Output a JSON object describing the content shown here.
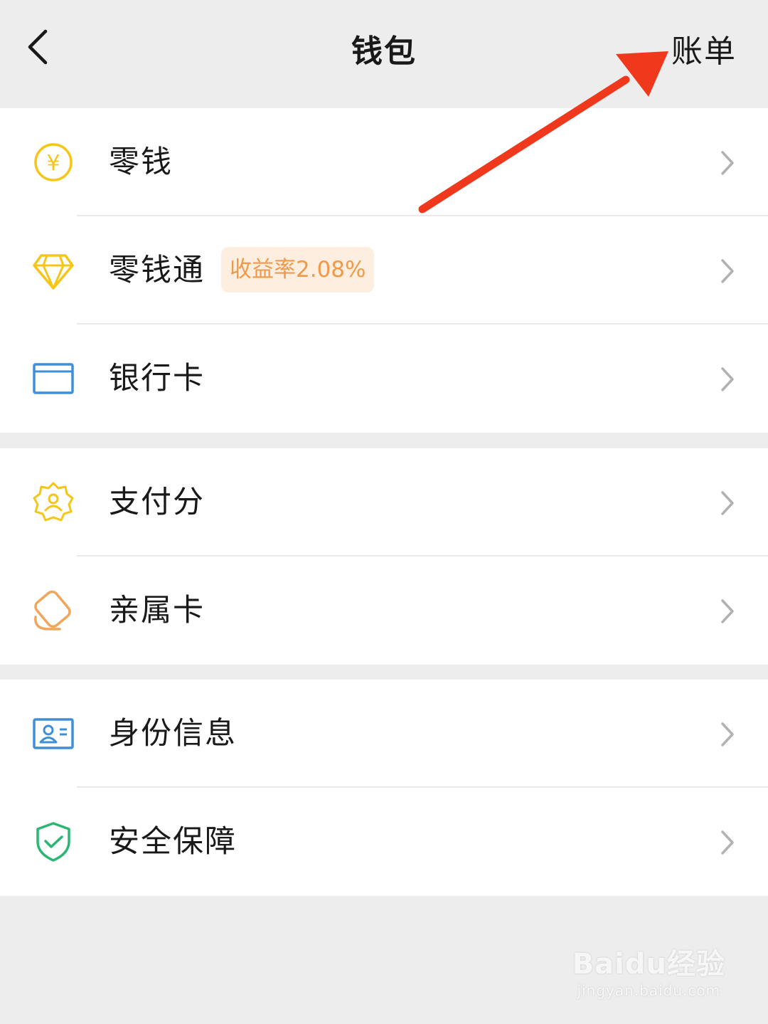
{
  "header": {
    "title": "钱包",
    "bill_label": "账单"
  },
  "groups": [
    {
      "items": [
        {
          "label": "零钱",
          "icon": "yuan-coin-icon"
        },
        {
          "label": "零钱通",
          "icon": "diamond-icon",
          "badge": "收益率2.08%"
        },
        {
          "label": "银行卡",
          "icon": "bank-card-icon"
        }
      ]
    },
    {
      "items": [
        {
          "label": "支付分",
          "icon": "pay-score-icon"
        },
        {
          "label": "亲属卡",
          "icon": "family-card-icon"
        }
      ]
    },
    {
      "items": [
        {
          "label": "身份信息",
          "icon": "id-card-icon"
        },
        {
          "label": "安全保障",
          "icon": "shield-check-icon"
        }
      ]
    }
  ],
  "watermark": {
    "main": "Baidu经验",
    "sub": "jingyan.baidu.com"
  },
  "colors": {
    "background": "#ededed",
    "yellow_icon": "#f5c518",
    "blue_icon": "#3d8fd8",
    "orange_icon": "#f0a65a",
    "green_icon": "#2bb673",
    "badge_bg": "#fdeee0",
    "badge_text": "#ee9a4a",
    "annotation_arrow": "#f0391c"
  }
}
